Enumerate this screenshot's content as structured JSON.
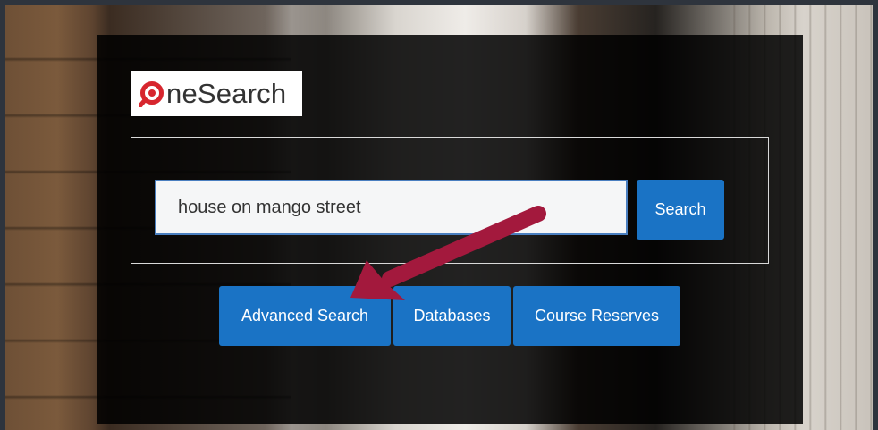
{
  "logo": {
    "text": "neSearch",
    "brand_color": "#d7262e"
  },
  "search": {
    "value": "house on mango street",
    "button_label": "Search"
  },
  "links": {
    "advanced_search": "Advanced Search",
    "databases": "Databases",
    "course_reserves": "Course Reserves"
  },
  "colors": {
    "button": "#1a73c5",
    "arrow": "#a3193d",
    "panel": "#000000"
  }
}
